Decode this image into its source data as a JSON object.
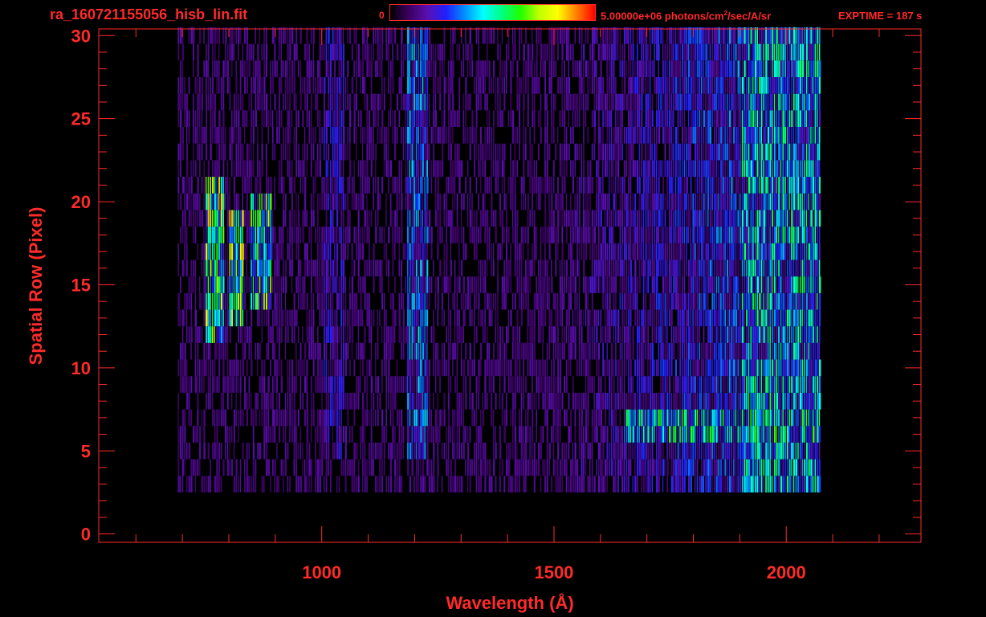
{
  "header": {
    "filename": "ra_160721155056_hisb_lin.fit",
    "colorbar_min_label": "0",
    "colorbar_max_label_main": "5.00000e+06 photons/cm",
    "colorbar_max_label_sup": "2",
    "colorbar_max_label_tail": "/sec/A/sr",
    "exptime_label": "EXPTIME = 187 s"
  },
  "colors": {
    "axes": "#ff2a2a",
    "background": "#000000",
    "colormap": [
      "#000000",
      "#3a0060",
      "#5a10b0",
      "#2020ff",
      "#0090ff",
      "#00ffff",
      "#00ff80",
      "#20ff00",
      "#c0ff00",
      "#ffff00",
      "#ff8000",
      "#ff0000"
    ]
  },
  "chart_data": {
    "type": "heatmap",
    "title": "ra_160721155056_hisb_lin.fit",
    "xlabel": "Wavelength (Å)",
    "ylabel": "Spatial Row (Pixel)",
    "xlim": [
      520,
      2290
    ],
    "ylim": [
      -0.5,
      30.4
    ],
    "x_ticks": [
      1000,
      1500,
      2000
    ],
    "x_tick_labels": [
      "1000",
      "1500",
      "2000"
    ],
    "y_ticks": [
      0,
      5,
      10,
      15,
      20,
      25,
      30
    ],
    "y_tick_labels": [
      "0",
      "5",
      "10",
      "15",
      "20",
      "25",
      "30"
    ],
    "colorbar_range": [
      0,
      5000000
    ],
    "colorbar_unit": "photons/cm^2/sec/A/sr",
    "exposure_time_s": 187,
    "data_extent_x": [
      690,
      2075
    ],
    "data_extent_y": [
      3,
      30
    ],
    "features": [
      {
        "label": "arc",
        "x_range": [
          750,
          790
        ],
        "y_range": [
          12,
          21
        ],
        "level": 0.6
      },
      {
        "label": "arc",
        "x_range": [
          800,
          830
        ],
        "y_range": [
          13,
          19
        ],
        "level": 0.6
      },
      {
        "label": "arc",
        "x_range": [
          845,
          890
        ],
        "y_range": [
          14,
          20
        ],
        "level": 0.55
      },
      {
        "label": "band",
        "x_range": [
          1180,
          1230
        ],
        "y_range": [
          5,
          30
        ],
        "level": 0.3
      },
      {
        "label": "band",
        "x_range": [
          1000,
          1050
        ],
        "y_range": [
          5,
          30
        ],
        "level": 0.2
      },
      {
        "label": "band",
        "x_range": [
          1650,
          2075
        ],
        "y_range": [
          6,
          7
        ],
        "level": 0.45
      },
      {
        "label": "band",
        "x_range": [
          1900,
          2075
        ],
        "y_range": [
          3,
          30
        ],
        "level": 0.4
      }
    ]
  }
}
